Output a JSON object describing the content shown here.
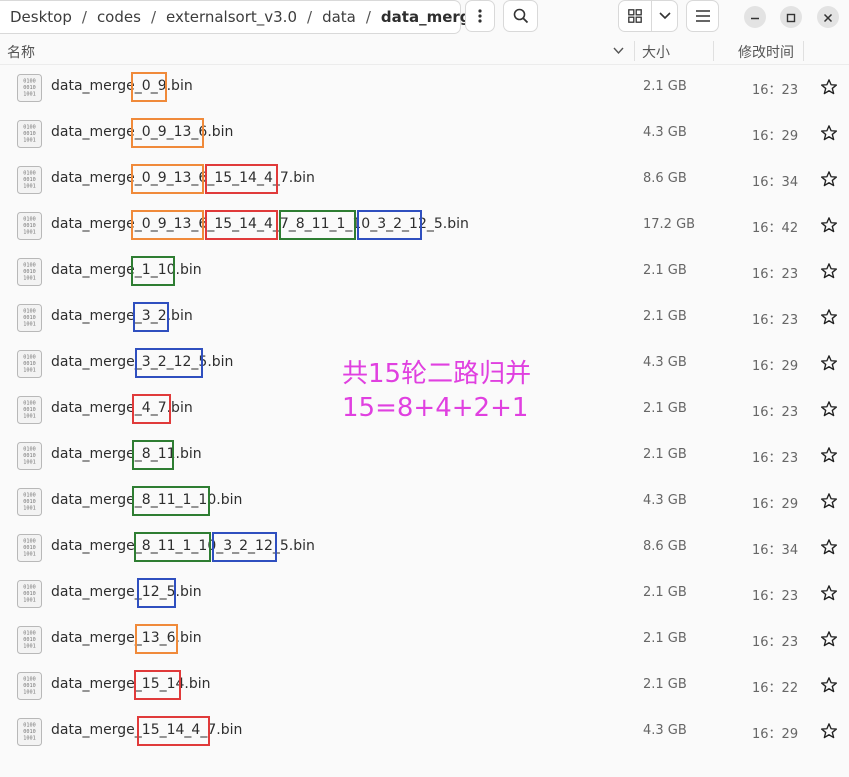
{
  "breadcrumb": [
    "Desktop",
    "codes",
    "externalsort_v3.0",
    "data",
    "data_merge"
  ],
  "columns": {
    "name": "名称",
    "size": "大小",
    "modified": "修改时间"
  },
  "icons": {
    "more": "vertical-dots-icon",
    "search": "search-icon",
    "view": "grid-view-icon",
    "dropdown": "chevron-down-icon",
    "menu": "hamburger-menu-icon",
    "minimize": "minimize-icon",
    "maximize": "maximize-icon",
    "close": "close-icon",
    "file": "binary-file-icon",
    "star": "star-icon"
  },
  "highlight_colors": {
    "orange": "#f08a3a",
    "red": "#e03a3a",
    "green": "#2e7d32",
    "blue": "#2f4fbf"
  },
  "files": [
    {
      "name": "data_merge_0_9.bin",
      "size": "2.1 GB",
      "time": "16：23"
    },
    {
      "name": "data_merge_0_9_13_6.bin",
      "size": "4.3 GB",
      "time": "16：29"
    },
    {
      "name": "data_merge_0_9_13_6_15_14_4_7.bin",
      "size": "8.6 GB",
      "time": "16：34"
    },
    {
      "name": "data_merge_0_9_13_6_15_14_4_7_8_11_1_10_3_2_12_5.bin",
      "size": "17.2 GB",
      "time": "16：42"
    },
    {
      "name": "data_merge_1_10.bin",
      "size": "2.1 GB",
      "time": "16：23"
    },
    {
      "name": "data_merge_3_2.bin",
      "size": "2.1 GB",
      "time": "16：23"
    },
    {
      "name": "data_merge_3_2_12_5.bin",
      "size": "4.3 GB",
      "time": "16：29"
    },
    {
      "name": "data_merge_4_7.bin",
      "size": "2.1 GB",
      "time": "16：23"
    },
    {
      "name": "data_merge_8_11.bin",
      "size": "2.1 GB",
      "time": "16：23"
    },
    {
      "name": "data_merge_8_11_1_10.bin",
      "size": "4.3 GB",
      "time": "16：29"
    },
    {
      "name": "data_merge_8_11_1_10_3_2_12_5.bin",
      "size": "8.6 GB",
      "time": "16：34"
    },
    {
      "name": "data_merge_12_5.bin",
      "size": "2.1 GB",
      "time": "16：23"
    },
    {
      "name": "data_merge_13_6.bin",
      "size": "2.1 GB",
      "time": "16：23"
    },
    {
      "name": "data_merge_15_14.bin",
      "size": "2.1 GB",
      "time": "16：22"
    },
    {
      "name": "data_merge_15_14_4_7.bin",
      "size": "4.3 GB",
      "time": "16：29"
    }
  ],
  "annotation": {
    "line1": "共15轮二路归并",
    "line2": "15=8+4+2+1"
  }
}
